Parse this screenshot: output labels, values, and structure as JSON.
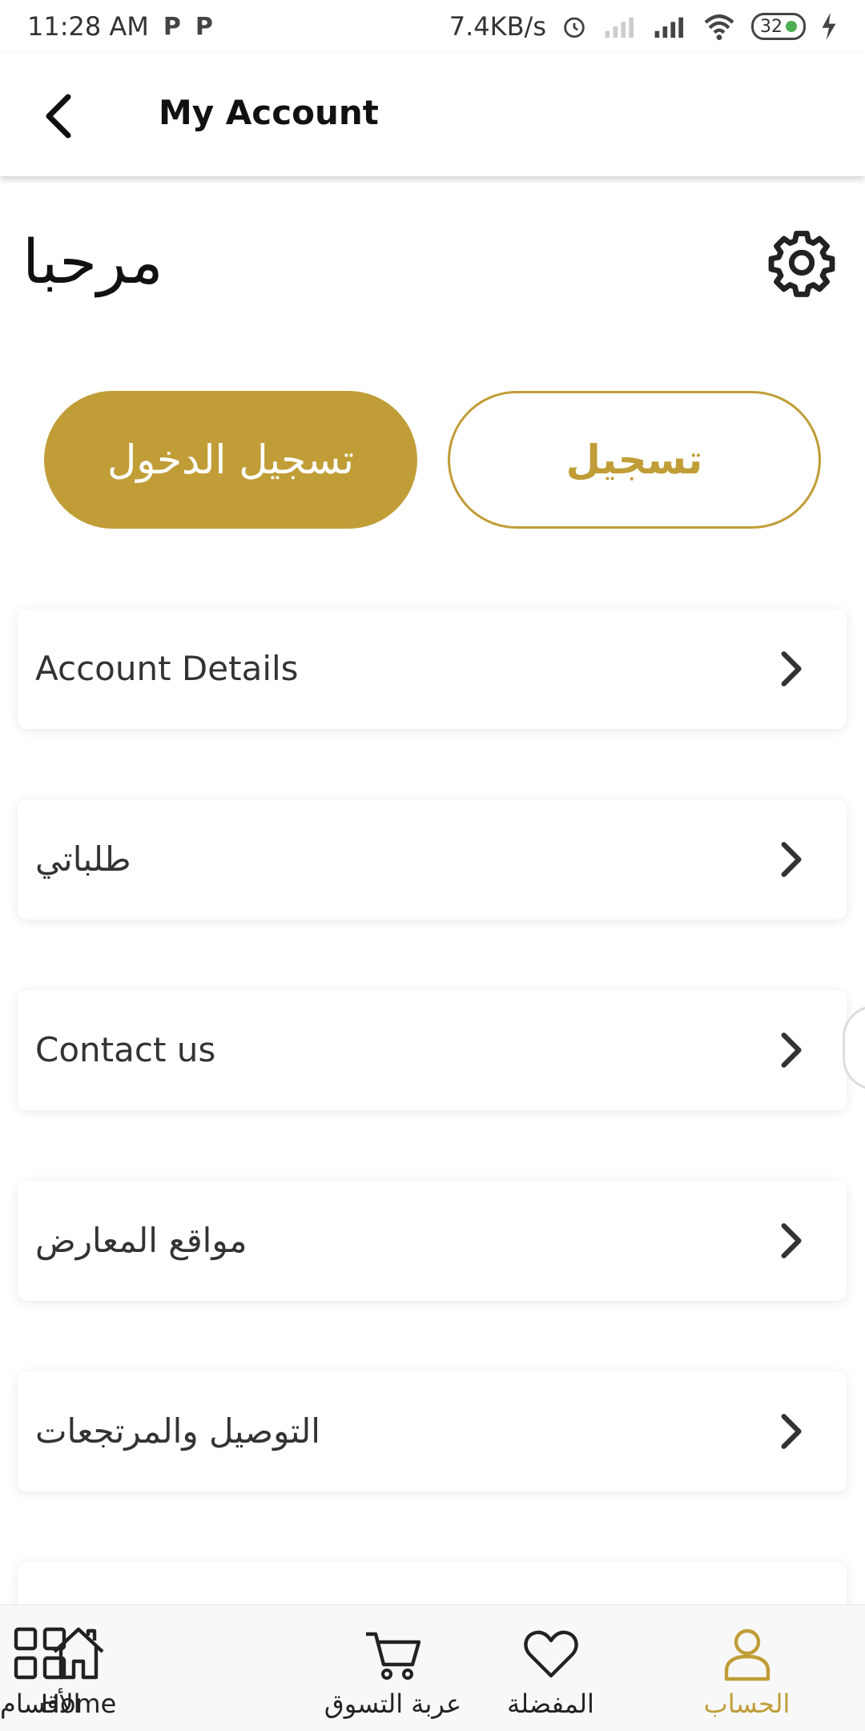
{
  "status_bar": {
    "time": "11:28 AM",
    "left_icons": [
      "P",
      "P"
    ],
    "network_speed": "7.4KB/s",
    "battery": "32"
  },
  "app_bar": {
    "title": "My Account",
    "back_icon": "chevron-left-icon"
  },
  "greeting": "مرحبا",
  "settings_icon": "gear-icon",
  "buttons": {
    "login": "تسجيل الدخول",
    "register": "تسجيل"
  },
  "menu": [
    {
      "label": "Account Details"
    },
    {
      "label": "طلباتي"
    },
    {
      "label": "Contact us"
    },
    {
      "label": "مواقع المعارض"
    },
    {
      "label": "التوصيل والمرتجعات"
    }
  ],
  "bottom_nav": [
    {
      "label": "Home",
      "icon": "home-icon"
    },
    {
      "label": "الأقسام",
      "icon": "grid-icon"
    },
    {
      "label": "عربة التسوق",
      "icon": "cart-icon"
    },
    {
      "label": "المفضلة",
      "icon": "heart-icon"
    },
    {
      "label": "الحساب",
      "icon": "person-icon",
      "active": true
    }
  ],
  "colors": {
    "accent": "#C09D37",
    "text": "#333333"
  }
}
